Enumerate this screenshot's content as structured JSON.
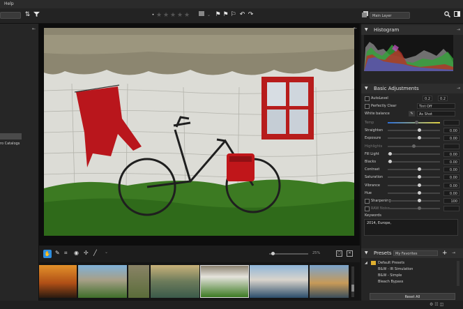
{
  "menubar": {
    "help": "Help"
  },
  "toolbar": {
    "rating_dot": "•",
    "stars": [
      "★",
      "★",
      "★",
      "★",
      "★"
    ],
    "layer_select": "Main Layer"
  },
  "left_panel": {
    "catalog_item": "ro Catalogs"
  },
  "right_panel": {
    "histogram": {
      "title": "Histogram"
    },
    "basic": {
      "title": "Basic Adjustments",
      "autolevel": {
        "label": "AutoLevel",
        "v1": "0.2",
        "v2": "0.2"
      },
      "perfectly_clear": {
        "label": "Perfectly Clear",
        "select": "Tint Off"
      },
      "white_balance": {
        "label": "White balance",
        "select": "As Shot"
      },
      "sliders": [
        {
          "label": "Temp",
          "value": "",
          "pos": 0.55,
          "dim": true,
          "gradient": "temp"
        },
        {
          "label": "Straighten",
          "value": "0.00",
          "pos": 0.6,
          "dim": false
        },
        {
          "label": "Exposure",
          "value": "0.00",
          "pos": 0.6,
          "dim": false
        },
        {
          "label": "Highlights",
          "value": "",
          "pos": 0.5,
          "dim": true
        },
        {
          "label": "Fill Light",
          "value": "0.00",
          "pos": 0.05,
          "dim": false
        },
        {
          "label": "Blacks",
          "value": "0.00",
          "pos": 0.05,
          "dim": false
        },
        {
          "label": "Contrast",
          "value": "0.00",
          "pos": 0.6,
          "dim": false
        },
        {
          "label": "Saturation",
          "value": "0.00",
          "pos": 0.6,
          "dim": false
        },
        {
          "label": "Vibrance",
          "value": "0.00",
          "pos": 0.6,
          "dim": false
        },
        {
          "label": "Hue",
          "value": "0.00",
          "pos": 0.6,
          "dim": false
        },
        {
          "label": "Sharpening",
          "value": "100",
          "pos": 0.6,
          "dim": false,
          "check": true
        },
        {
          "label": "RAW Noise",
          "value": "",
          "pos": 0.6,
          "dim": true,
          "check": true
        }
      ]
    },
    "keywords": {
      "label": "Keywords",
      "value": "2014, Europe,"
    },
    "presets": {
      "title": "Presets",
      "select": "My Favorites",
      "folder": "Default Presets",
      "items": [
        "B&W - IR Simulation",
        "B&W - Simple",
        "Bleach Bypass"
      ],
      "reset_label": "Reset All"
    }
  },
  "viewer": {
    "zoom": "25%"
  },
  "colors": {
    "accent": "#2d8ee0",
    "panel": "#252525",
    "window_red": "#b71c1c"
  }
}
